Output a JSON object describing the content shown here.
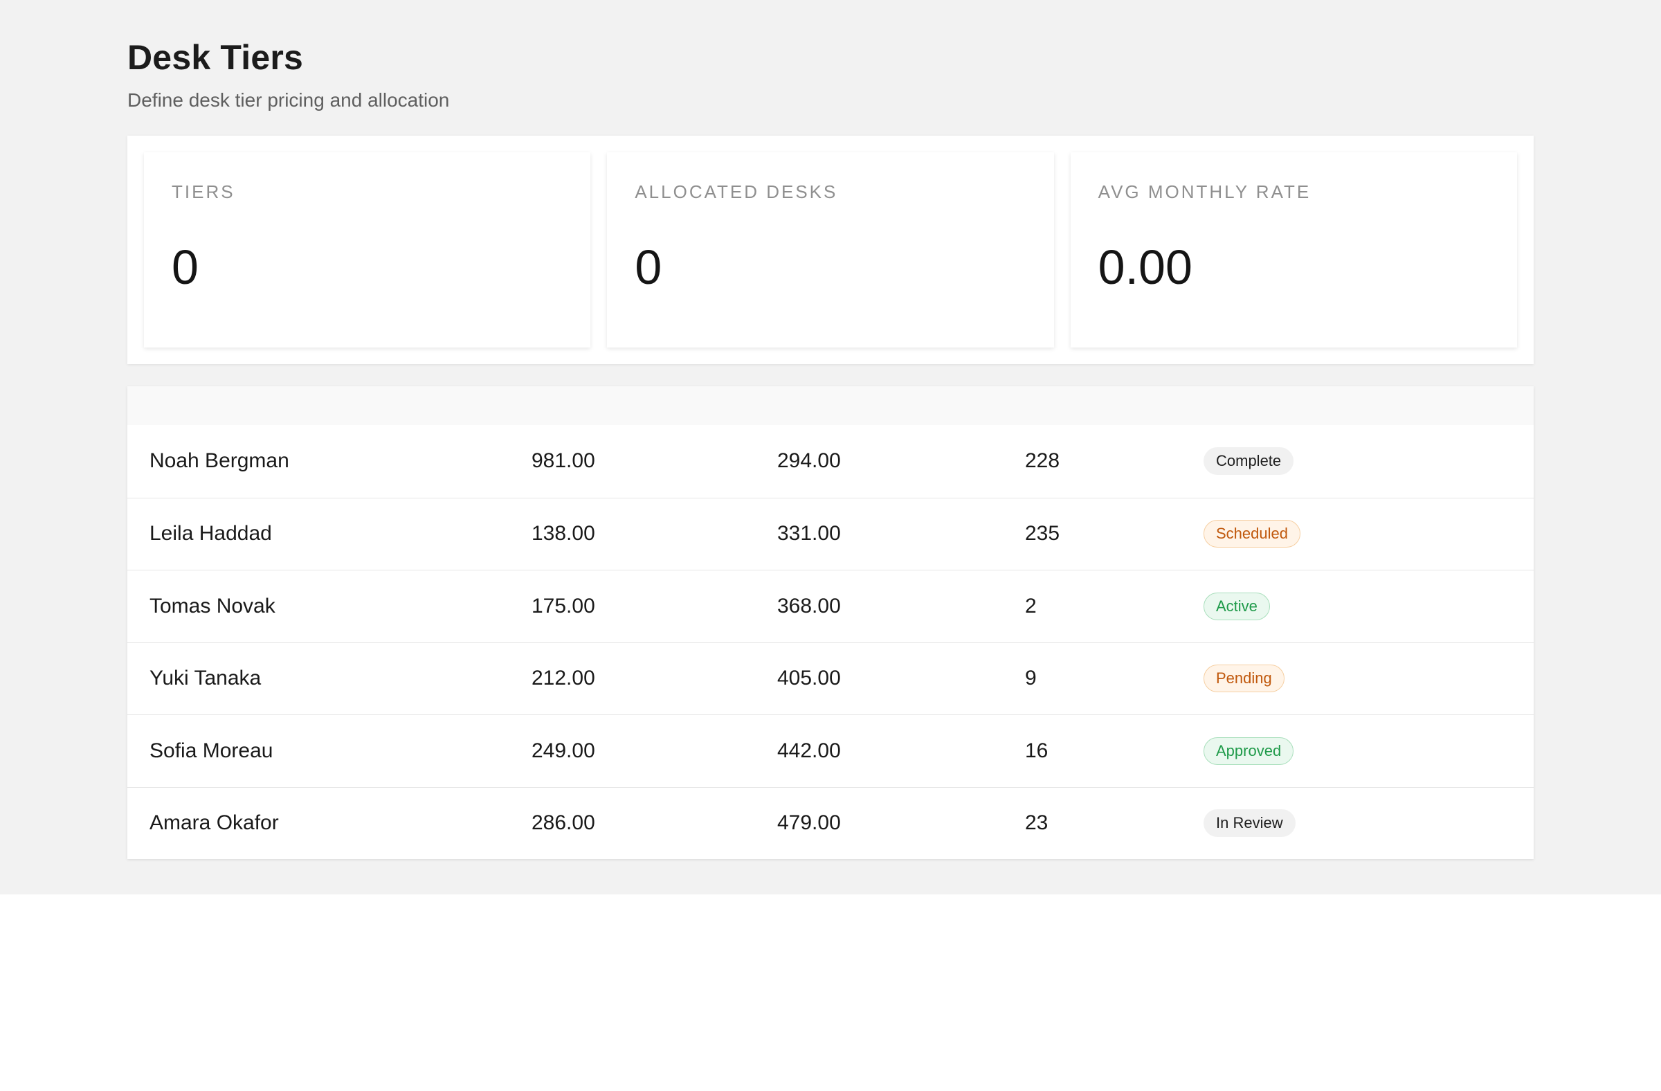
{
  "header": {
    "title": "Desk Tiers",
    "subtitle": "Define desk tier pricing and allocation"
  },
  "stats": [
    {
      "label": "TIERS",
      "value": "0"
    },
    {
      "label": "ALLOCATED DESKS",
      "value": "0"
    },
    {
      "label": "AVG MONTHLY RATE",
      "value": "0.00"
    }
  ],
  "table": {
    "rows": [
      {
        "name": "Noah Bergman",
        "a": "981.00",
        "b": "294.00",
        "c": "228",
        "status": "Complete"
      },
      {
        "name": "Leila Haddad",
        "a": "138.00",
        "b": "331.00",
        "c": "235",
        "status": "Scheduled"
      },
      {
        "name": "Tomas Novak",
        "a": "175.00",
        "b": "368.00",
        "c": "2",
        "status": "Active"
      },
      {
        "name": "Yuki Tanaka",
        "a": "212.00",
        "b": "405.00",
        "c": "9",
        "status": "Pending"
      },
      {
        "name": "Sofia Moreau",
        "a": "249.00",
        "b": "442.00",
        "c": "16",
        "status": "Approved"
      },
      {
        "name": "Amara Okafor",
        "a": "286.00",
        "b": "479.00",
        "c": "23",
        "status": "In Review"
      }
    ]
  },
  "status_colors": {
    "Complete": {
      "bg": "#f1f1f1",
      "border": "#f1f1f1",
      "text": "#1e1e1e"
    },
    "In Review": {
      "bg": "#f1f1f1",
      "border": "#f1f1f1",
      "text": "#1e1e1e"
    },
    "Scheduled": {
      "bg": "#fff4e8",
      "border": "#f6cfa2",
      "text": "#c0580c"
    },
    "Pending": {
      "bg": "#fff4e8",
      "border": "#f6cfa2",
      "text": "#c0580c"
    },
    "Active": {
      "bg": "#eaf8ef",
      "border": "#a9dfbc",
      "text": "#1e9a49"
    },
    "Approved": {
      "bg": "#eaf8ef",
      "border": "#a9dfbc",
      "text": "#1e9a49"
    }
  }
}
